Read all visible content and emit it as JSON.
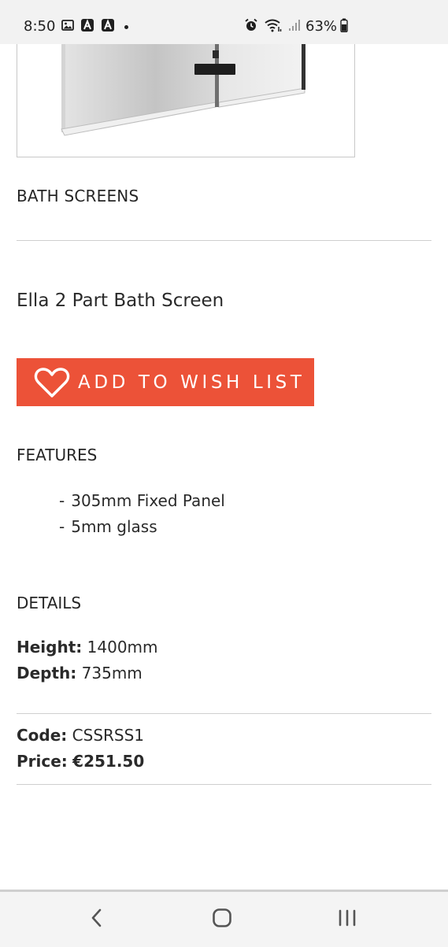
{
  "status_bar": {
    "time": "8:50",
    "battery": "63%",
    "icons": [
      "image-icon",
      "app-icon",
      "app-icon",
      "dot-icon",
      "alarm-icon",
      "wifi-icon",
      "signal-icon",
      "battery-icon"
    ]
  },
  "product": {
    "category": "BATH SCREENS",
    "title": "Ella 2 Part Bath Screen",
    "wishlist_label": "ADD TO WISH LIST",
    "accent_color": "#ec5238"
  },
  "features": {
    "heading": "FEATURES",
    "items": [
      "305mm Fixed Panel",
      "5mm glass"
    ]
  },
  "details": {
    "heading": "DETAILS",
    "height_label": "Height:",
    "height_value": "1400mm",
    "depth_label": "Depth:",
    "depth_value": "735mm"
  },
  "purchase": {
    "code_label": "Code:",
    "code_value": "CSSRSS1",
    "price_label": "Price:",
    "price_value": "€251.50"
  },
  "nav": {
    "icons": [
      "back-icon",
      "home-icon",
      "recents-icon"
    ]
  }
}
